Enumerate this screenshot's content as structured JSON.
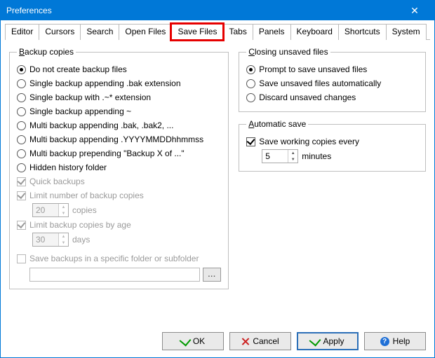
{
  "window": {
    "title": "Preferences"
  },
  "tabs": [
    "Editor",
    "Cursors",
    "Search",
    "Open Files",
    "Save Files",
    "Tabs",
    "Panels",
    "Keyboard",
    "Shortcuts",
    "System"
  ],
  "active_tab_index": 4,
  "backup": {
    "legend": "Backup copies",
    "radios": [
      "Do not create backup files",
      "Single backup appending .bak extension",
      "Single backup with .~* extension",
      "Single backup appending ~",
      "Multi backup appending .bak, .bak2, ...",
      "Multi backup appending .YYYYMMDDhhmmss",
      "Multi backup prepending \"Backup X of ...\"",
      "Hidden history folder"
    ],
    "selected_radio": 0,
    "quick": "Quick backups",
    "limit_num": "Limit number of backup copies",
    "limit_num_val": "20",
    "copies_label": "copies",
    "limit_age": "Limit backup copies by age",
    "limit_age_val": "30",
    "days_label": "days",
    "specific": "Save backups in a specific folder or subfolder",
    "browse": "..."
  },
  "closing": {
    "legend": "Closing unsaved files",
    "radios": [
      "Prompt to save unsaved files",
      "Save unsaved files automatically",
      "Discard unsaved changes"
    ],
    "selected_radio": 0
  },
  "autosave": {
    "legend": "Automatic save",
    "label": "Save working copies every",
    "value": "5",
    "unit": "minutes"
  },
  "buttons": {
    "ok": "OK",
    "cancel": "Cancel",
    "apply": "Apply",
    "help": "Help"
  }
}
